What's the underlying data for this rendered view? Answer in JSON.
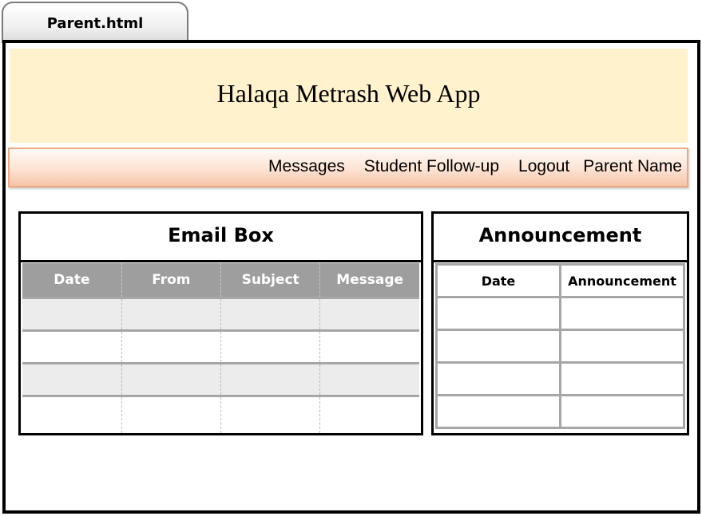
{
  "window": {
    "tab_label": "Parent.html"
  },
  "header": {
    "title": "Halaqa Metrash Web App"
  },
  "nav": {
    "items": [
      {
        "label": "Messages"
      },
      {
        "label": "Student Follow-up"
      },
      {
        "label": "Logout"
      },
      {
        "label": "Parent Name"
      }
    ]
  },
  "email_box": {
    "title": "Email Box",
    "columns": [
      "Date",
      "From",
      "Subject",
      "Message"
    ],
    "row_count": 4
  },
  "announcement": {
    "title": "Announcement",
    "columns": [
      "Date",
      "Announcement"
    ],
    "row_count": 4
  },
  "colors": {
    "header_bg": "#fff2cc",
    "nav_border": "#f0a880",
    "table_header_bg": "#9e9e9e",
    "stripe_bg": "#ececec"
  }
}
